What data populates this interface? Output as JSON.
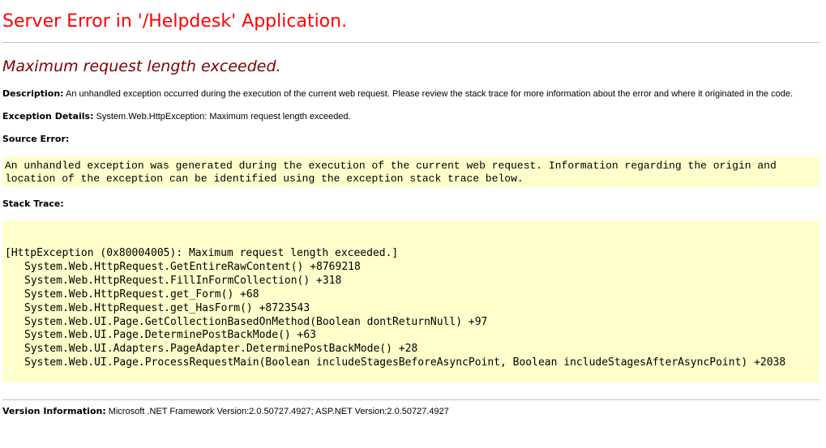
{
  "header": {
    "title": "Server Error in '/Helpdesk' Application.",
    "error_message": "Maximum request length exceeded."
  },
  "description": {
    "label": "Description:",
    "text": " An unhandled exception occurred during the execution of the current web request. Please review the stack trace for more information about the error and where it originated in the code."
  },
  "exception_details": {
    "label": "Exception Details:",
    "text": " System.Web.HttpException: Maximum request length exceeded."
  },
  "source_error": {
    "label": "Source Error:",
    "lines": [
      "An unhandled exception was generated during the execution of the current web request. Information regarding the origin and",
      "location of the exception can be identified using the exception stack trace below."
    ]
  },
  "stack_trace": {
    "label": "Stack Trace:",
    "header_line": "[HttpException (0x80004005): Maximum request length exceeded.]",
    "frames": [
      "System.Web.HttpRequest.GetEntireRawContent() +8769218",
      "System.Web.HttpRequest.FillInFormCollection() +318",
      "System.Web.HttpRequest.get_Form() +68",
      "System.Web.HttpRequest.get_HasForm() +8723543",
      "System.Web.UI.Page.GetCollectionBasedOnMethod(Boolean dontReturnNull) +97",
      "System.Web.UI.Page.DeterminePostBackMode() +63",
      "System.Web.UI.Adapters.PageAdapter.DeterminePostBackMode() +28",
      "System.Web.UI.Page.ProcessRequestMain(Boolean includeStagesBeforeAsyncPoint, Boolean includeStagesAfterAsyncPoint) +2038"
    ]
  },
  "version_information": {
    "label": "Version Information:",
    "text": " Microsoft .NET Framework Version:2.0.50727.4927; ASP.NET Version:2.0.50727.4927"
  },
  "colors": {
    "title": "#ff0000",
    "error_message": "#800000",
    "code_background": "#ffffcc",
    "rule": "#c0c0c0"
  }
}
